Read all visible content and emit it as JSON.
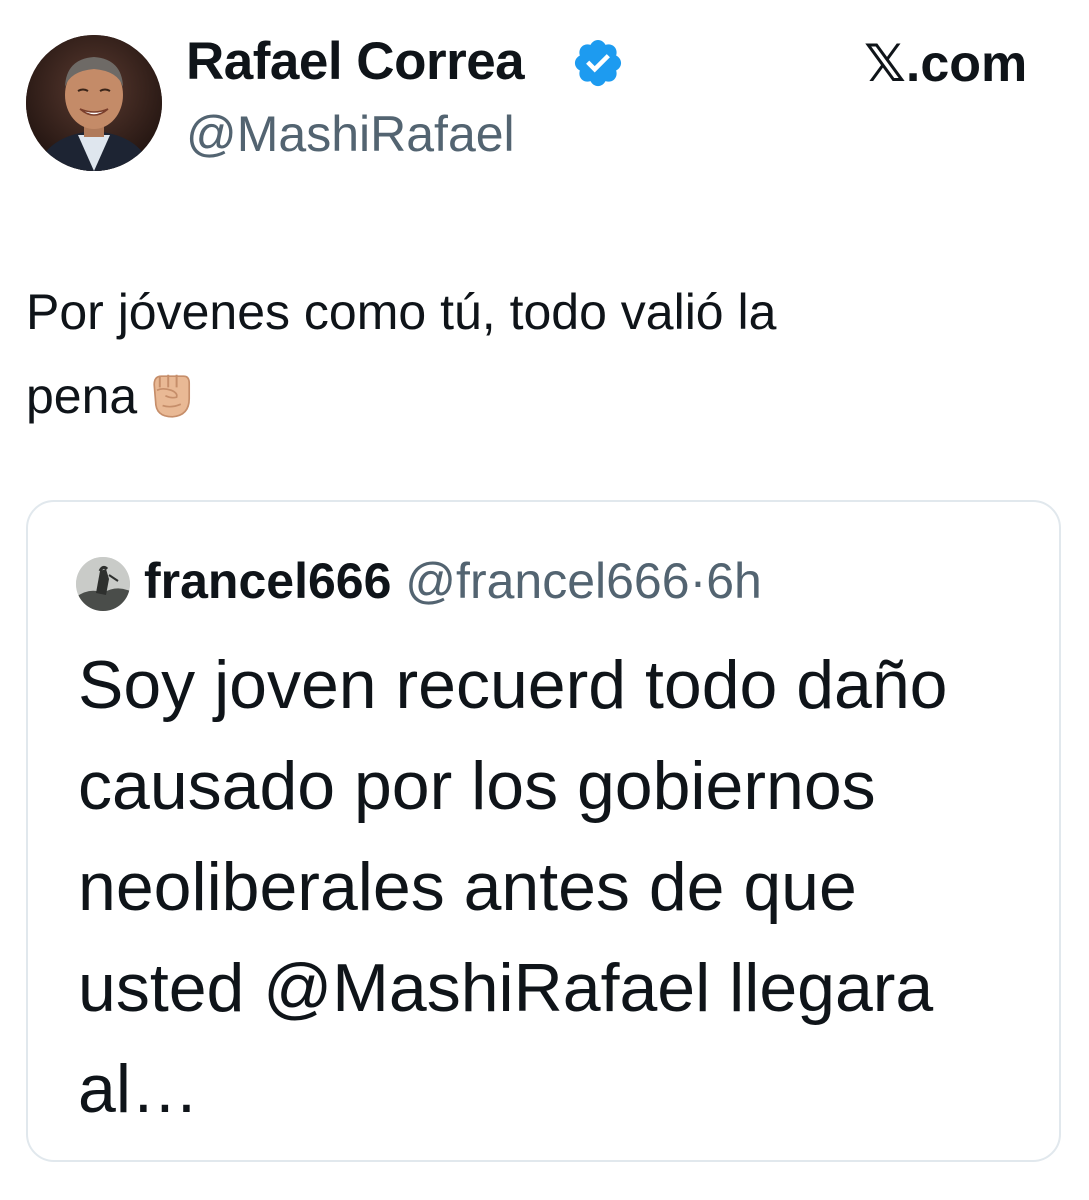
{
  "author": {
    "display_name": "Rafael Correa",
    "handle": "@MashiRafael",
    "avatar_icon": "profile-photo",
    "verified": true,
    "verified_color": "#1d9bf0"
  },
  "site": {
    "label": "𝕏.com"
  },
  "tweet": {
    "text_line1": "Por jóvenes como tú, todo valió la",
    "text_line2": "pena",
    "emoji_icon": "raised-fist-icon"
  },
  "quoted_tweet": {
    "author_name": "francel666",
    "author_handle": "@francel666",
    "separator": "·",
    "time": "6h",
    "text": "Soy joven recuerd todo daño causado por los gobiernos neoliberales antes de que usted @MashiRafael llegara al…"
  },
  "colors": {
    "text": "#0f1419",
    "secondary": "#536471",
    "border": "#e1e8ed"
  }
}
